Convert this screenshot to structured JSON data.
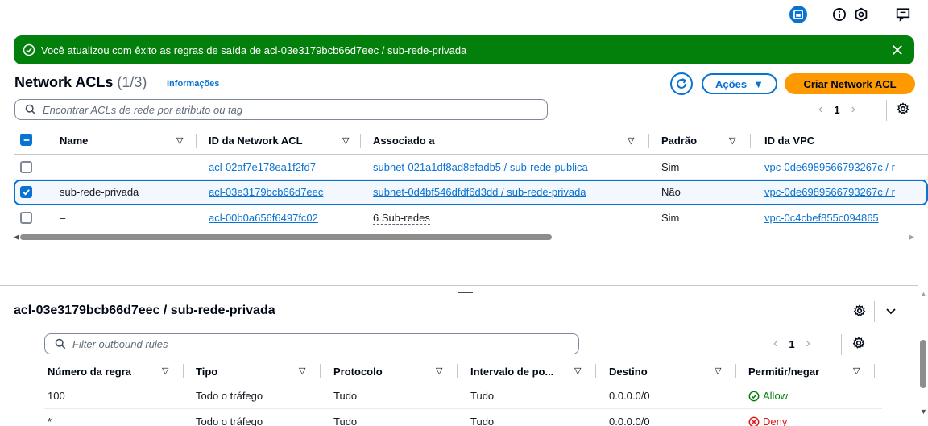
{
  "topbar": {
    "icons": [
      "panel-icon",
      "info-icon",
      "settings-hex-icon",
      "feedback-icon"
    ]
  },
  "flash": {
    "message": "Você atualizou com êxito as regras de saída de acl-03e3179bcb66d7eec / sub-rede-privada",
    "color": "#037f0c"
  },
  "header": {
    "title": "Network ACLs",
    "count": "(1/3)",
    "info": "Informações",
    "actions": "Ações",
    "create": "Criar Network ACL"
  },
  "search": {
    "placeholder": "Encontrar ACLs de rede por atributo ou tag"
  },
  "pager": {
    "page": "1"
  },
  "table": {
    "columns": [
      "Name",
      "ID da Network ACL",
      "Associado a",
      "Padrão",
      "ID da VPC"
    ],
    "rows": [
      {
        "name": "–",
        "id": "acl-02af7e178ea1f2fd7",
        "assoc": "subnet-021a1df8ad8efadb5 / sub-rede-publica",
        "default": "Sim",
        "vpc": "vpc-0de6989566793267c / r",
        "selected": false
      },
      {
        "name": "sub-rede-privada",
        "id": "acl-03e3179bcb66d7eec",
        "assoc": "subnet-0d4bf546dfdf6d3dd / sub-rede-privada",
        "default": "Não",
        "vpc": "vpc-0de6989566793267c / r",
        "selected": true
      },
      {
        "name": "–",
        "id": "acl-00b0a656f6497fc02",
        "assoc": "6 Sub-redes",
        "default": "Sim",
        "vpc": "vpc-0c4cbef855c094865",
        "selected": false
      }
    ]
  },
  "split": {
    "title": "acl-03e3179bcb66d7eec / sub-rede-privada",
    "search_placeholder": "Filter outbound rules",
    "page": "1",
    "columns": [
      "Número da regra",
      "Tipo",
      "Protocolo",
      "Intervalo de po...",
      "Destino",
      "Permitir/negar"
    ],
    "rows": [
      {
        "rule": "100",
        "type": "Todo o tráfego",
        "protocol": "Tudo",
        "range": "Tudo",
        "dest": "0.0.0.0/0",
        "action": "Allow",
        "action_kind": "allow"
      },
      {
        "rule": "*",
        "type": "Todo o tráfego",
        "protocol": "Tudo",
        "range": "Tudo",
        "dest": "0.0.0.0/0",
        "action": "Deny",
        "action_kind": "deny"
      }
    ]
  },
  "colors": {
    "accent": "#0972d3",
    "primary_button": "#ff9900",
    "success": "#037f0c",
    "error": "#d91515"
  }
}
